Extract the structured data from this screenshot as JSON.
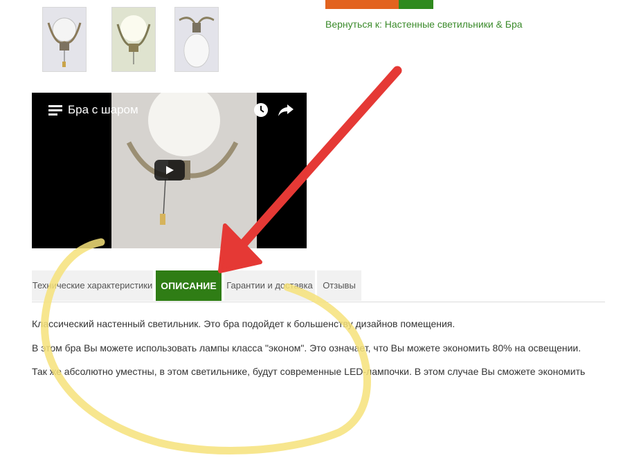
{
  "header": {
    "back_link": "Вернуться к: Настенные светильники & Бра"
  },
  "gallery": {
    "thumbnails": [
      "wall-lamp-front",
      "wall-lamp-lit",
      "wall-lamp-globe"
    ]
  },
  "video": {
    "title": "Бра с шаром"
  },
  "tabs": [
    {
      "label": "Технические характеристики"
    },
    {
      "label": "ОПИСАНИЕ"
    },
    {
      "label": "Гарантии и доставка"
    },
    {
      "label": "Отзывы"
    }
  ],
  "description": {
    "p1": "Классический настенный светильник. Это бра подойдет к большенству дизайнов помещения.",
    "p2": "В этом бра Вы можете использовать лампы класса \"эконом\". Это означает, что Вы можете экономить 80% на освещении.",
    "p3": "Так же абсолютно уместны, в этом светильнике, будут современные LED-лампочки. В этом случае Вы сможете экономить"
  },
  "colors": {
    "accent_green": "#2f7d15",
    "link_green": "#3a8a2a",
    "button_orange": "#e2631f",
    "arrow_red": "#e53935",
    "annotation_yellow": "#f6e27a"
  }
}
